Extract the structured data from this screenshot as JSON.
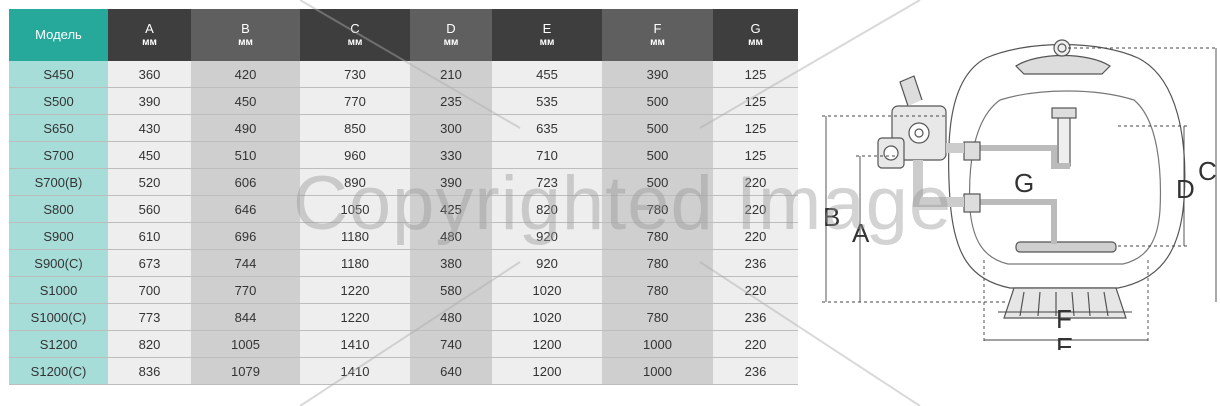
{
  "table": {
    "headers": [
      {
        "label": "Модель",
        "unit": ""
      },
      {
        "label": "A",
        "unit": "мм"
      },
      {
        "label": "B",
        "unit": "мм"
      },
      {
        "label": "C",
        "unit": "мм"
      },
      {
        "label": "D",
        "unit": "мм"
      },
      {
        "label": "E",
        "unit": "мм"
      },
      {
        "label": "F",
        "unit": "мм"
      },
      {
        "label": "G",
        "unit": "мм"
      }
    ],
    "rows": [
      [
        "S450",
        "360",
        "420",
        "730",
        "210",
        "455",
        "390",
        "125"
      ],
      [
        "S500",
        "390",
        "450",
        "770",
        "235",
        "535",
        "500",
        "125"
      ],
      [
        "S650",
        "430",
        "490",
        "850",
        "300",
        "635",
        "500",
        "125"
      ],
      [
        "S700",
        "450",
        "510",
        "960",
        "330",
        "710",
        "500",
        "125"
      ],
      [
        "S700(B)",
        "520",
        "606",
        "890",
        "390",
        "723",
        "500",
        "220"
      ],
      [
        "S800",
        "560",
        "646",
        "1050",
        "425",
        "820",
        "780",
        "220"
      ],
      [
        "S900",
        "610",
        "696",
        "1180",
        "480",
        "920",
        "780",
        "220"
      ],
      [
        "S900(C)",
        "673",
        "744",
        "1180",
        "380",
        "920",
        "780",
        "236"
      ],
      [
        "S1000",
        "700",
        "770",
        "1220",
        "580",
        "1020",
        "780",
        "220"
      ],
      [
        "S1000(C)",
        "773",
        "844",
        "1220",
        "480",
        "1020",
        "780",
        "236"
      ],
      [
        "S1200",
        "820",
        "1005",
        "1410",
        "740",
        "1200",
        "1000",
        "220"
      ],
      [
        "S1200(C)",
        "836",
        "1079",
        "1410",
        "640",
        "1200",
        "1000",
        "236"
      ]
    ]
  },
  "diagram": {
    "labels": {
      "a": "A",
      "b": "B",
      "c": "C",
      "d": "D",
      "e": "E",
      "f": "F",
      "g": "G"
    }
  },
  "watermark": {
    "text": "Copyrighted Image"
  },
  "colors": {
    "teal_header": "#26a89a",
    "teal_cells": "#a7ddd8",
    "dark_header": "#3e3e3e",
    "mid_header": "#5f5f5f",
    "light_cells": "#eeeeee",
    "grey_cells": "#cfcfcf"
  }
}
